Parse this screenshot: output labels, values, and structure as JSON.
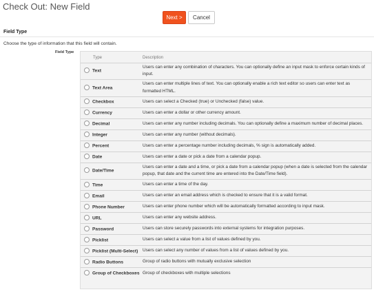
{
  "page": {
    "title": "Check Out: New Field"
  },
  "buttons": {
    "next": "Next >",
    "cancel": "Cancel"
  },
  "section": {
    "title": "Field Type",
    "instruction": "Choose the type of information that this field will contain.",
    "field_label": "Field Type"
  },
  "table": {
    "headers": {
      "type": "Type",
      "description": "Description"
    },
    "rows": [
      {
        "type": "Text",
        "description": "Users can enter any combination of characters. You can optionally define an input mask to enforce certain kinds of input.",
        "lines": 2,
        "selected": false
      },
      {
        "type": "Text Area",
        "description": "Users can enter multiple lines of text. You can optionally enable a rich text editor so users can enter text as formatted HTML.",
        "lines": 2,
        "selected": false
      },
      {
        "type": "Checkbox",
        "description": "Users can select a Checked (true) or Unchecked (false) value.",
        "lines": 1,
        "selected": false
      },
      {
        "type": "Currency",
        "description": "Users can enter a dollar or other currency amount.",
        "lines": 1,
        "selected": false
      },
      {
        "type": "Decimal",
        "description": "Users can enter any number including decimals. You can optionally define a maximum number of decimal places.",
        "lines": 1,
        "selected": false
      },
      {
        "type": "Integer",
        "description": "Users can enter any number (without decimals).",
        "lines": 1,
        "selected": false
      },
      {
        "type": "Percent",
        "description": "Users can enter a percentage number including decimals, % sign is automatically added.",
        "lines": 1,
        "selected": false
      },
      {
        "type": "Date",
        "description": "Users can enter a date or pick a date from a calendar popup.",
        "lines": 1,
        "selected": false
      },
      {
        "type": "Date/Time",
        "description": "Users can enter a date and a time, or pick a date from a calendar popup (when a date is selected from the calendar popup, that date and the current time are entered into the Date/Time field).",
        "lines": 2,
        "selected": false
      },
      {
        "type": "Time",
        "description": "Users can enter a time of the day.",
        "lines": 1,
        "selected": false
      },
      {
        "type": "Email",
        "description": "Users can enter an email address which is checked to ensure that it is a valid format.",
        "lines": 1,
        "selected": false
      },
      {
        "type": "Phone Number",
        "description": "Users can enter phone number which will be automatically formatted according to input mask.",
        "lines": 1,
        "selected": false
      },
      {
        "type": "URL",
        "description": "Users can enter any website address.",
        "lines": 1,
        "selected": false
      },
      {
        "type": "Password",
        "description": "Users can store securely passwords into external systems for integration purposes.",
        "lines": 1,
        "selected": false
      },
      {
        "type": "Picklist",
        "description": "Users can select a value from a list of values defined by you.",
        "lines": 1,
        "selected": false
      },
      {
        "type": "Picklist (Multi-Select)",
        "description": "Users can select any number of values from a list of values defined by you.",
        "lines": 1,
        "selected": false
      },
      {
        "type": "Radio Buttons",
        "description": "Group of radio buttons with mutually exclusive selection",
        "lines": 1,
        "selected": false
      },
      {
        "type": "Group of Checkboxes",
        "description": "Group of checkboxes with multiple selections",
        "lines": 1,
        "selected": false
      }
    ]
  },
  "colors": {
    "next_button": "#f0521e",
    "table_background": "#f3f3f3",
    "row_divider": "#d2d2d2"
  }
}
